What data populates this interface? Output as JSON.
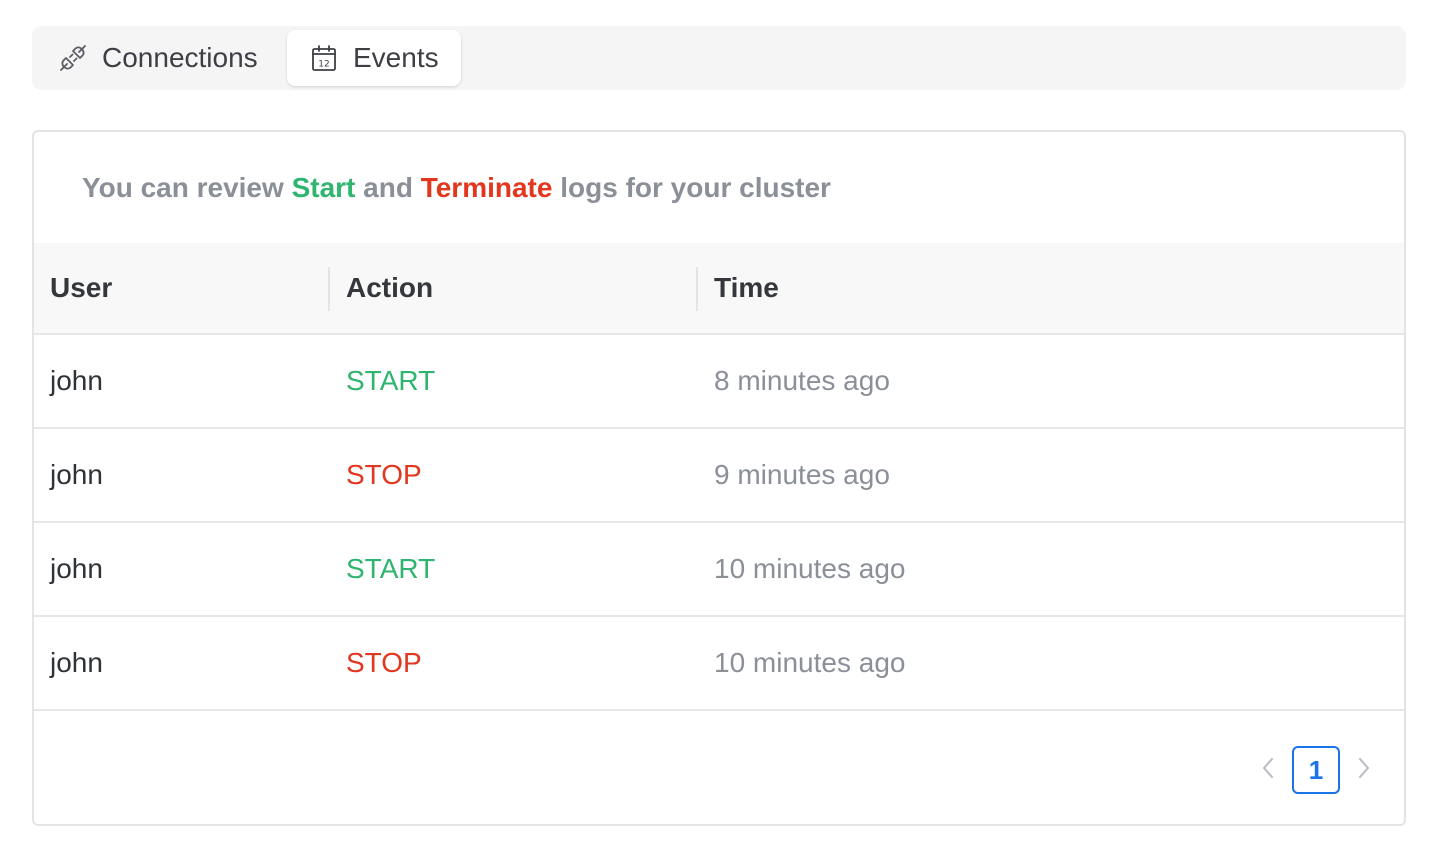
{
  "tabs": [
    {
      "label": "Connections",
      "icon": "plug-icon",
      "active": false
    },
    {
      "label": "Events",
      "icon": "calendar-icon",
      "active": true
    }
  ],
  "intro": {
    "prefix": "You can review ",
    "start_word": "Start",
    "middle": " and ",
    "terminate_word": "Terminate",
    "suffix": " logs for your cluster"
  },
  "table": {
    "headers": [
      "User",
      "Action",
      "Time"
    ],
    "rows": [
      {
        "user": "john",
        "action": "START",
        "time": "8 minutes ago"
      },
      {
        "user": "john",
        "action": "STOP",
        "time": "9 minutes ago"
      },
      {
        "user": "john",
        "action": "START",
        "time": "10 minutes ago"
      },
      {
        "user": "john",
        "action": "STOP",
        "time": "10 minutes ago"
      }
    ]
  },
  "pagination": {
    "current_page": "1"
  },
  "colors": {
    "start": "#2fb56f",
    "stop": "#e2361e",
    "accent": "#1a73e8"
  }
}
